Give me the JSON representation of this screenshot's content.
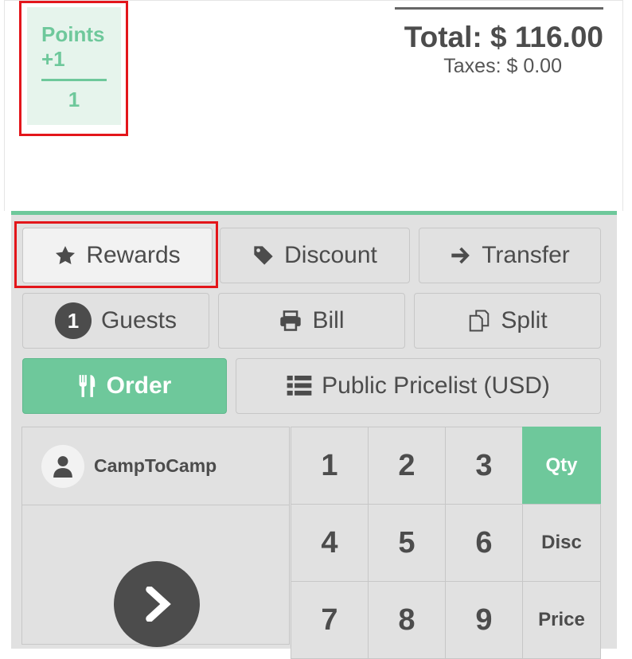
{
  "points": {
    "title": "Points",
    "delta": "+1",
    "total": "1"
  },
  "totals": {
    "total": "Total: $ 116.00",
    "taxes": "Taxes: $ 0.00"
  },
  "actions": {
    "rewards": "Rewards",
    "discount": "Discount",
    "transfer": "Transfer",
    "guests_count": "1",
    "guests": "Guests",
    "bill": "Bill",
    "split": "Split",
    "order": "Order",
    "pricelist": "Public Pricelist (USD)"
  },
  "customer": {
    "name": "CampToCamp"
  },
  "numpad": {
    "keys": [
      "1",
      "2",
      "3",
      "4",
      "5",
      "6",
      "7",
      "8",
      "9"
    ],
    "modes": [
      "Qty",
      "Disc",
      "Price"
    ],
    "active_mode": "Qty"
  },
  "colors": {
    "accent": "#6ec89b",
    "highlight": "#e3161b",
    "panel": "#e1e1e1",
    "text": "#4c4c4c"
  }
}
